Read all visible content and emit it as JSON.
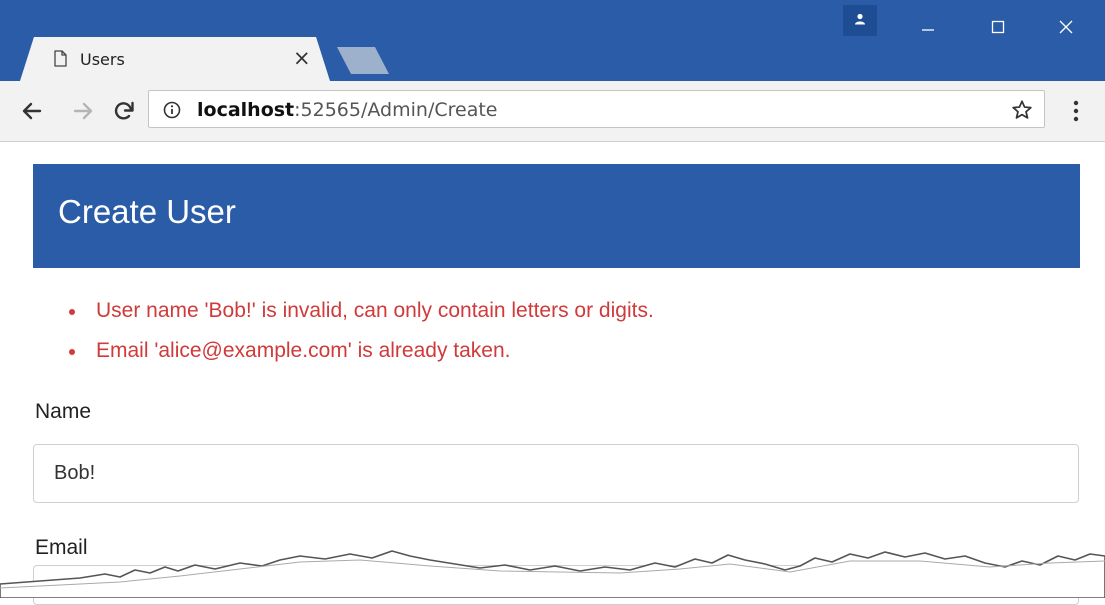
{
  "browser": {
    "tab": {
      "title": "Users",
      "close_glyph": "×"
    },
    "omnibox": {
      "host": "localhost",
      "port_path": ":52565/Admin/Create"
    },
    "icons": {
      "tab": "document-icon",
      "profile": "person-icon",
      "minimize": "minimize-icon",
      "maximize": "maximize-icon",
      "close": "close-icon",
      "back": "arrow-left-icon",
      "forward": "arrow-right-icon",
      "reload": "reload-icon",
      "info": "info-icon",
      "bookmark": "star-icon",
      "menu": "more-vertical-icon"
    },
    "colors": {
      "chrome": "#2b5ca8",
      "toolbar": "#f2f2f2"
    }
  },
  "page": {
    "header": {
      "title": "Create User"
    },
    "errors": [
      "User name 'Bob!' is invalid, can only contain letters or digits.",
      "Email 'alice@example.com' is already taken."
    ],
    "form": {
      "name_label": "Name",
      "name_value": "Bob!",
      "email_label": "Email"
    },
    "colors": {
      "header": "#2b5ca8",
      "error": "#d03a3a"
    }
  }
}
